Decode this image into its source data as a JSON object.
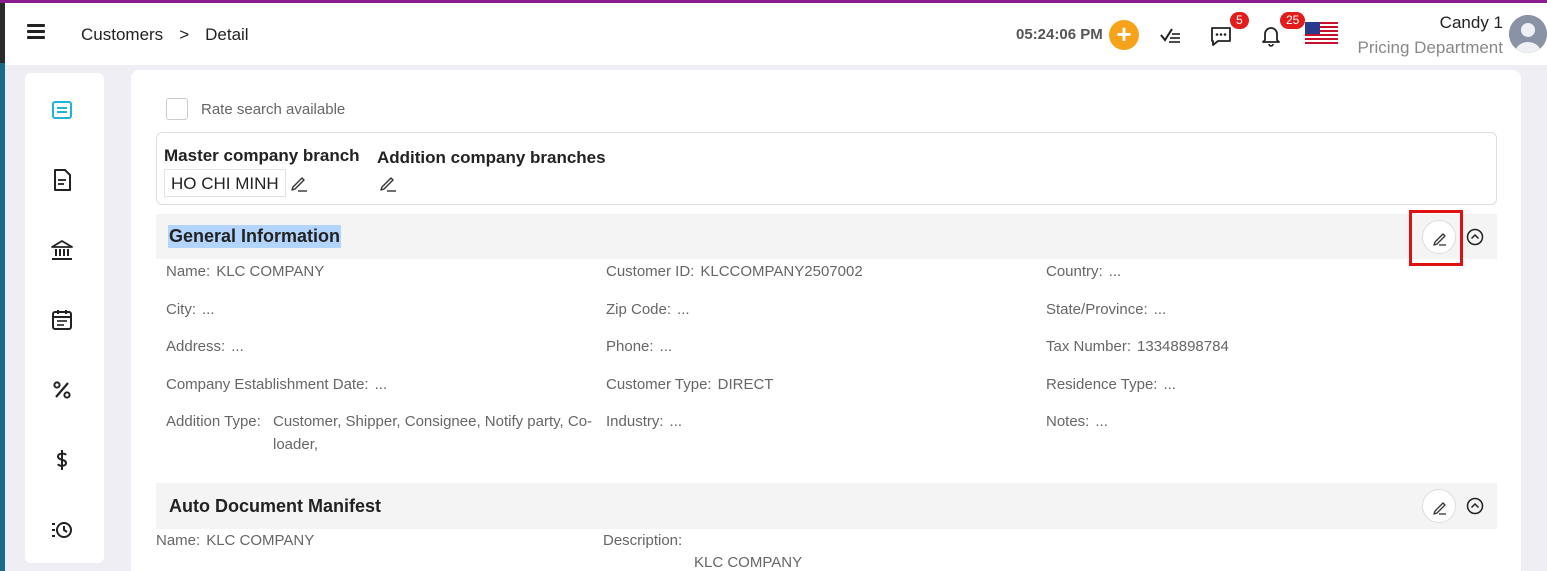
{
  "header": {
    "breadcrumb": [
      "Customers",
      ">",
      "Detail"
    ],
    "time": "05:24:06 PM",
    "plus_label": "+",
    "messages_count": "5",
    "notifications_count": "25",
    "user_name": "Candy 1",
    "user_department": "Pricing Department"
  },
  "sidebar": {
    "items": [
      "list-icon",
      "document-icon",
      "bank-icon",
      "calendar-icon",
      "percent-icon",
      "dollar-icon",
      "history-icon"
    ],
    "accent": "#1eb4d8"
  },
  "rate_search": {
    "label": "Rate search available"
  },
  "branches": {
    "master_label": "Master company branch",
    "master_value": "HO CHI MINH",
    "addition_label": "Addition company branches"
  },
  "general": {
    "title": "General Information",
    "fields": [
      {
        "label": "Name:",
        "value": "KLC COMPANY"
      },
      {
        "label": "Customer ID:",
        "value": "KLCCOMPANY2507002"
      },
      {
        "label": "Country:",
        "value": "..."
      },
      {
        "label": "City:",
        "value": "..."
      },
      {
        "label": "Zip Code:",
        "value": "..."
      },
      {
        "label": "State/Province:",
        "value": "..."
      },
      {
        "label": "Address:",
        "value": "..."
      },
      {
        "label": "Phone:",
        "value": "..."
      },
      {
        "label": "Tax Number:",
        "value": "13348898784"
      },
      {
        "label": "Company Establishment Date:",
        "value": "..."
      },
      {
        "label": "Customer Type:",
        "value": "DIRECT"
      },
      {
        "label": "Residence Type:",
        "value": "..."
      },
      {
        "label": "Addition Type:",
        "value": "Customer, Shipper, Consignee, Notify party, Co-",
        "value2": "loader,"
      },
      {
        "label": "Industry:",
        "value": "..."
      },
      {
        "label": "Notes:",
        "value": "..."
      }
    ]
  },
  "manifest": {
    "title": "Auto Document Manifest",
    "name_label": "Name:",
    "name_value": "KLC COMPANY",
    "description_label": "Description:",
    "description_value": "KLC COMPANY"
  },
  "colors": {
    "highlight": "#e01111",
    "selection": "#b3d4fc",
    "badge": "#e21b1b",
    "plus": "#f7a21b"
  }
}
